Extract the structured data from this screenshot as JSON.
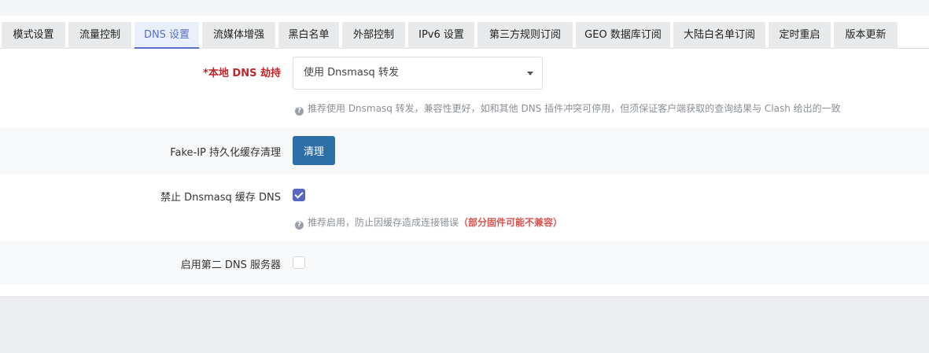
{
  "tabs": [
    {
      "label": "模式设置"
    },
    {
      "label": "流量控制"
    },
    {
      "label": "DNS 设置"
    },
    {
      "label": "流媒体增强"
    },
    {
      "label": "黑白名单"
    },
    {
      "label": "外部控制"
    },
    {
      "label": "IPv6 设置"
    },
    {
      "label": "第三方规则订阅"
    },
    {
      "label": "GEO 数据库订阅"
    },
    {
      "label": "大陆白名单订阅"
    },
    {
      "label": "定时重启"
    },
    {
      "label": "版本更新"
    }
  ],
  "active_tab": "DNS 设置",
  "accent_color": "#5a6dc5",
  "dns_hijack": {
    "label": "*本地 DNS 劫持",
    "selected": "使用 Dnsmasq 转发",
    "hint": "推荐使用 Dnsmasq 转发，兼容性更好，如和其他 DNS 插件冲突可停用，但须保证客户端获取的查询结果与 Clash 给出的一致"
  },
  "fakeip_flush": {
    "label": "Fake-IP 持久化缓存清理",
    "button": "清理"
  },
  "disable_dnsmasq_cache": {
    "label": "禁止 Dnsmasq 缓存 DNS",
    "checked": true,
    "hint": "推荐启用，防止因缓存造成连接错误",
    "warning": "（部分固件可能不兼容）"
  },
  "second_dns": {
    "label": "启用第二 DNS 服务器",
    "checked": false
  }
}
